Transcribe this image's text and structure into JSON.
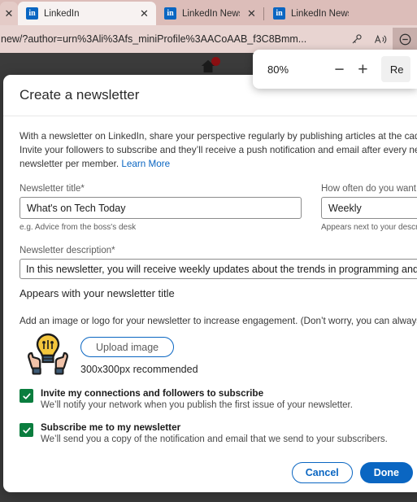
{
  "browser": {
    "tabs": [
      {
        "title": "",
        "active": false,
        "partial": true,
        "icon": "linkedin-icon"
      },
      {
        "title": "LinkedIn",
        "active": true,
        "partial": false,
        "icon": "linkedin-icon"
      },
      {
        "title": "LinkedIn Newsletters -",
        "active": false,
        "partial": false,
        "icon": "linkedin-icon"
      },
      {
        "title": "LinkedIn News",
        "active": false,
        "partial": false,
        "icon": "linkedin-icon"
      }
    ],
    "address": {
      "url": "new/?author=urn%3Ali%3Afs_miniProfile%3AACoAAB_f3C8Bmm...",
      "key_icon": "key-icon",
      "read_aloud_icon": "read-aloud-icon",
      "zoom_out_icon": "zoom-out-icon"
    },
    "zoom_popup": {
      "level": "80%",
      "minus_label": "−",
      "plus_label": "+",
      "reset_label": "Re"
    }
  },
  "dialog": {
    "title": "Create a newsletter",
    "intro_lines": [
      "With a newsletter on LinkedIn, share your perspective regularly by publishing articles at the cadence",
      "Invite your followers to subscribe and they’ll receive a push notification and email after every new ed",
      "newsletter per member. "
    ],
    "learn_more": "Learn More",
    "title_field": {
      "label": "Newsletter title*",
      "value": "What's on Tech Today",
      "hint": "e.g. Advice from the boss's desk"
    },
    "cadence_field": {
      "label": "How often do you want",
      "value": "Weekly",
      "hint": "Appears next to your descri"
    },
    "description_field": {
      "label": "Newsletter description*",
      "value": "In this newsletter, you will receive weekly updates about the trends in programming and software d",
      "hint": "Appears with your newsletter title"
    },
    "upload": {
      "intro": "Add an image or logo for your newsletter to increase engagement. (Don’t worry, you can always add",
      "button_label": "Upload image",
      "hint": "300x300px recommended",
      "art_icon": "lightbulb-with-hands-icon"
    },
    "checkboxes": [
      {
        "checked": true,
        "title": "Invite my connections and followers to subscribe",
        "subtitle": "We’ll notify your network when you publish the first issue of your newsletter."
      },
      {
        "checked": true,
        "title": "Subscribe me to my newsletter",
        "subtitle": "We’ll send you a copy of the notification and email that we send to your subscribers."
      }
    ],
    "footer": {
      "cancel_label": "Cancel",
      "done_label": "Done"
    }
  },
  "page": {
    "home_icon": "home-icon",
    "notification_badge": true
  },
  "colors": {
    "linkedin_blue": "#0a66c2",
    "checkbox_green": "#0a7d3e",
    "tabstrip_bg": "#dcbdb9",
    "addressbar_bg": "#e8d4d1",
    "page_bg": "#3b3b3b"
  }
}
